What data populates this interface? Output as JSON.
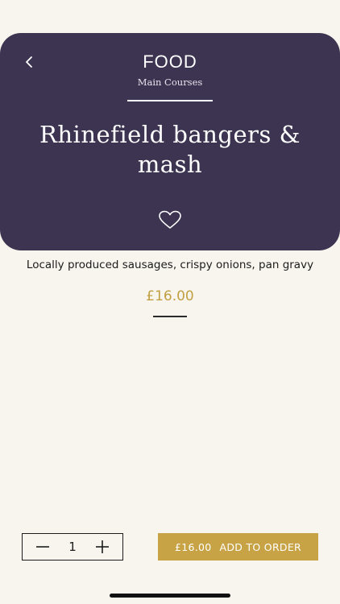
{
  "header": {
    "category": "FOOD",
    "subcategory": "Main Courses",
    "item_title": "Rhinefield bangers & mash",
    "back_icon": "chevron-left-icon",
    "favorite_icon": "heart-outline-icon"
  },
  "item": {
    "description": "Locally produced sausages, crispy onions, pan gravy",
    "price": "£16.00"
  },
  "order": {
    "quantity": "1",
    "minus_icon": "minus-icon",
    "plus_icon": "plus-icon",
    "button_price": "£16.00",
    "button_label": "ADD TO ORDER"
  },
  "colors": {
    "header_bg": "#3c3450",
    "accent_gold": "#c8a346",
    "page_bg": "#f8f5ee"
  }
}
